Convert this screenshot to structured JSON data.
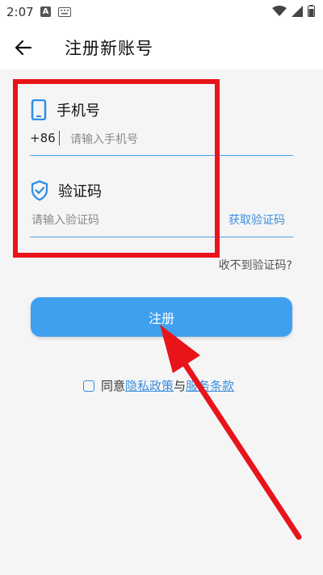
{
  "status_bar": {
    "time": "2:07",
    "notification_icon": "A"
  },
  "header": {
    "title": "注册新账号"
  },
  "phone": {
    "label": "手机号",
    "country_code": "+86",
    "placeholder": "请输入手机号"
  },
  "verification": {
    "label": "验证码",
    "placeholder": "请输入验证码",
    "get_code_label": "获取验证码",
    "not_received": "收不到验证码?"
  },
  "register_button": {
    "label": "注册"
  },
  "agreement": {
    "prefix": "同意",
    "privacy_link": "隐私政策",
    "conjunction": "与",
    "terms_link": "服务条款"
  },
  "colors": {
    "accent": "#3fa0f0",
    "link": "#3b8ede",
    "annotation_red": "#e8141a"
  }
}
